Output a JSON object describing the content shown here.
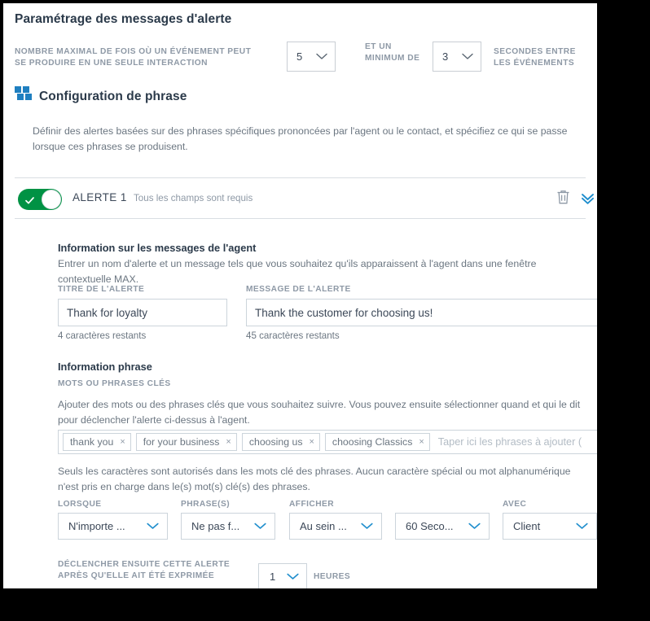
{
  "page": {
    "title": "Paramétrage des messages d'alerte"
  },
  "max_events": {
    "label": "Nombre maximal de fois où un événement peut se produire en une seule interaction",
    "value": "5",
    "middle_label": "Et un minimum de",
    "min_value": "3",
    "suffix_label": "secondes entre les événements"
  },
  "phrase_config": {
    "icon": "quote-icon",
    "heading": "Configuration de phrase",
    "description": "Définir des alertes basées sur des phrases spécifiques prononcées par l'agent ou le contact, et spécifiez ce qui se passe lorsque ces phrases se produisent."
  },
  "alert": {
    "toggle_on": true,
    "name": "ALERTE 1",
    "hint": "Tous les champs sont requis",
    "delete_icon": "trash-icon",
    "collapse_icon": "double-chevron-down-icon"
  },
  "agent_message": {
    "heading": "Information sur les messages de l'agent",
    "description": "Entrer un nom d'alerte et un message tels que vous souhaitez qu'ils apparaissent à l'agent dans une fenêtre contextuelle MAX.",
    "title_label": "Titre de l'alerte",
    "title_value": "Thank for loyalty",
    "title_remaining": "4 caractères restants",
    "message_label": "Message de l'alerte",
    "message_value": "Thank the customer for choosing us!",
    "message_remaining": "45 caractères restants"
  },
  "phrase_info": {
    "heading": "Information phrase",
    "keywords_label": "Mots ou phrases clés",
    "keywords_description": "Ajouter des mots ou des phrases clés que vous souhaitez suivre. Vous pouvez ensuite sélectionner quand et qui le dit pour déclencher l'alerte ci-dessus à l'agent.",
    "tags": [
      "thank you",
      "for your business",
      "choosing us",
      "choosing Classics"
    ],
    "tag_remove_glyph": "×",
    "input_placeholder": "Taper ici les phrases à ajouter (",
    "note": "Seuls les caractères sont autorisés dans les mots clé des phrases. Aucun caractère spécial ou mot alphanumérique n'est pris en charge dans le(s) mot(s) clé(s) des phrases."
  },
  "conditions": {
    "labels": {
      "when": "Lorsque",
      "phrases": "Phrase(s)",
      "display": "Afficher",
      "with": "Avec"
    },
    "values": {
      "when": "N'importe ...",
      "phrases": "Ne pas f...",
      "display": "Au sein ...",
      "duration": "60 Seco...",
      "with": "Client"
    }
  },
  "retrigger": {
    "label": "Déclencher ensuite cette alerte après qu'elle ait été exprimée",
    "value": "1",
    "unit": "heures"
  },
  "colors": {
    "accent_blue": "#1f8ecd",
    "toggle_green": "#009244",
    "heading": "#2b3a4a",
    "muted": "#8e99a6"
  }
}
